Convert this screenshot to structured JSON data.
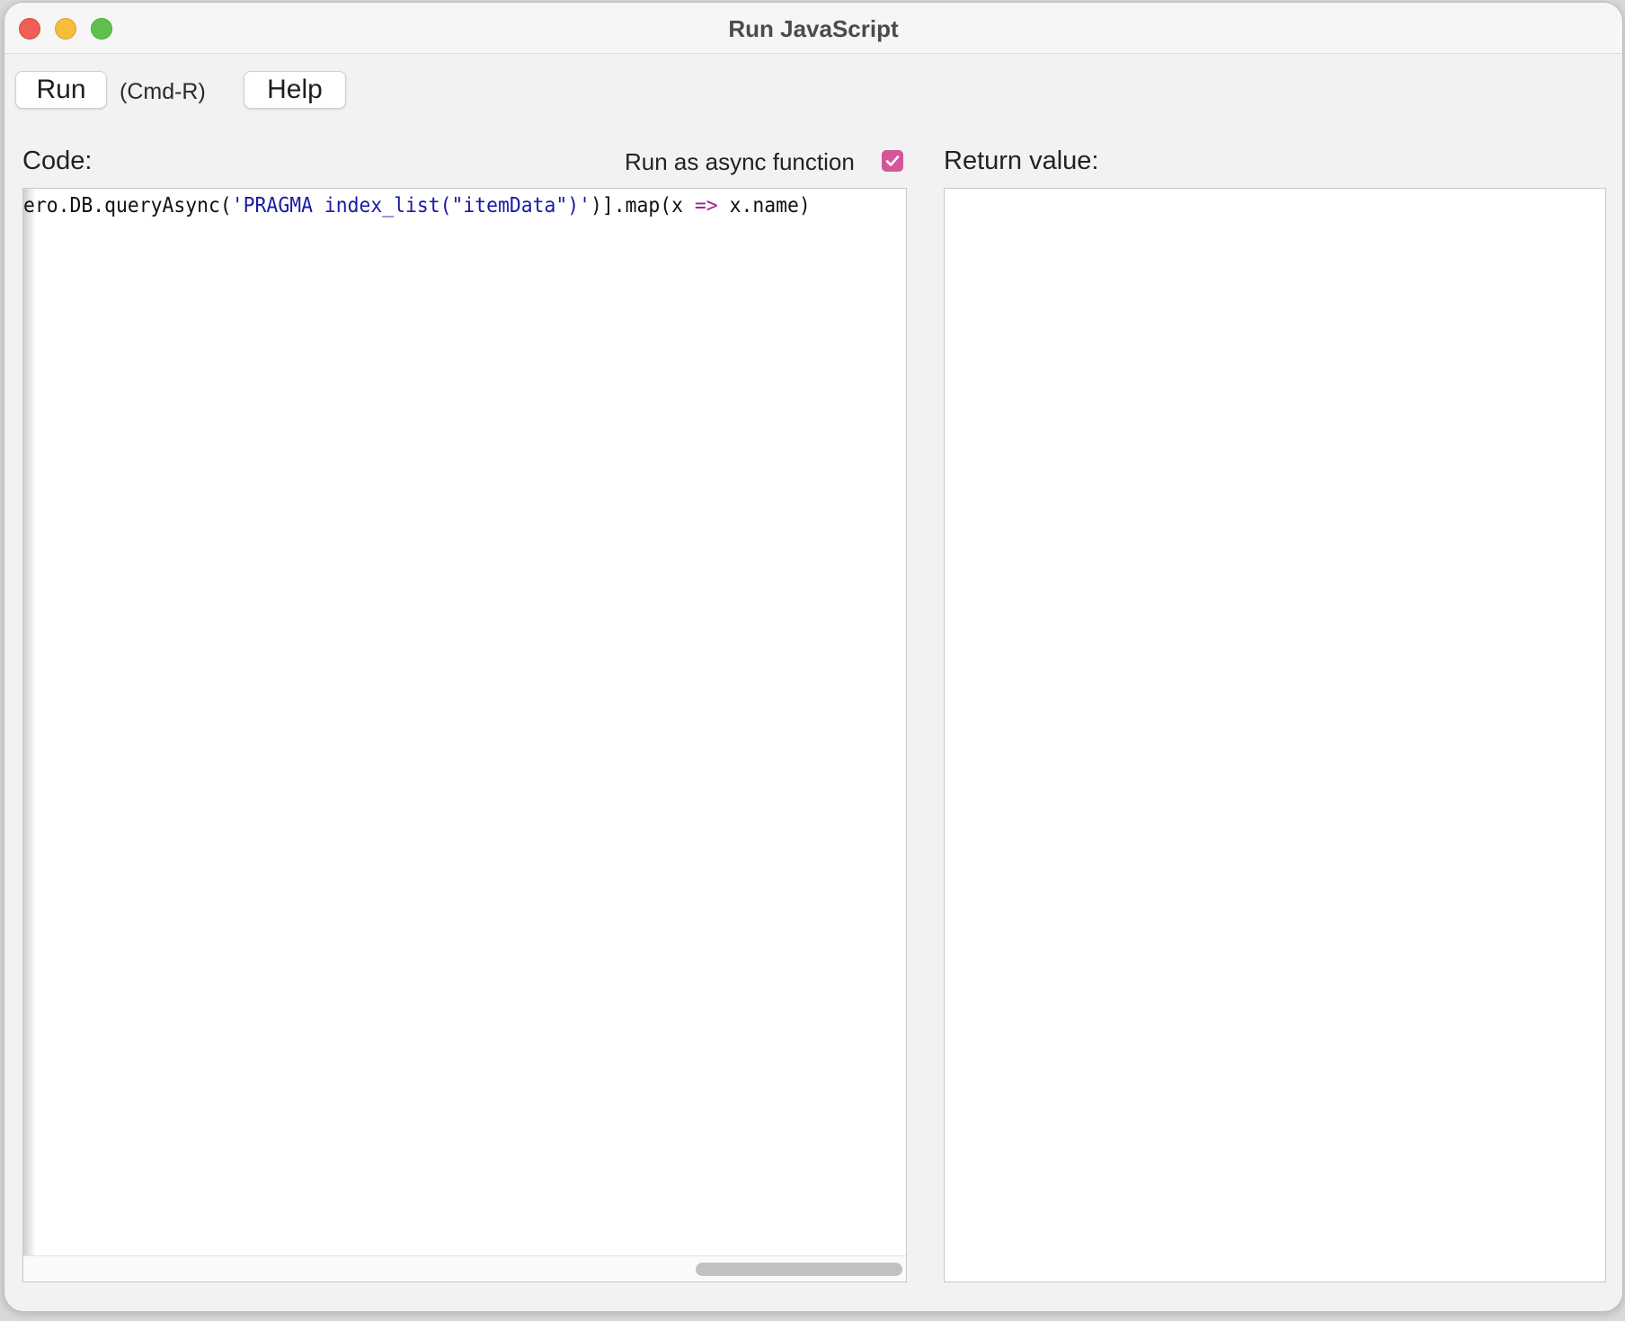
{
  "window": {
    "title": "Run JavaScript"
  },
  "toolbar": {
    "run_label": "Run",
    "shortcut": "(Cmd-R)",
    "help_label": "Help"
  },
  "code_panel": {
    "label": "Code:",
    "async_option_label": "Run as async function",
    "async_checked": true,
    "code": {
      "prefix": "ero.DB.queryAsync(",
      "string": "'PRAGMA index_list(\"itemData\")'",
      "middle": ")].map(x ",
      "arrow": "=>",
      "suffix": " x.name)"
    }
  },
  "return_panel": {
    "label": "Return value:",
    "value": ""
  },
  "colors": {
    "checkbox": "#d4559a",
    "string": "#1a1aa6",
    "arrow": "#9c2796",
    "close": "#ee5f57",
    "minimize": "#f6bd3b",
    "zoom": "#5fc04e"
  }
}
